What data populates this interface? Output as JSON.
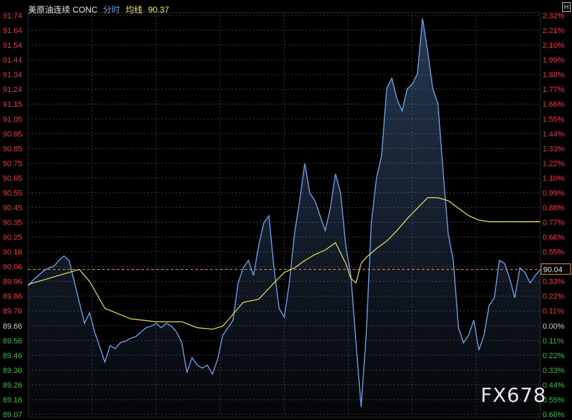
{
  "header": {
    "instrument": "美原油连续 CONC",
    "mode": "分时",
    "avg_label": "均线",
    "avg_value": "90.37"
  },
  "current_price_tag": "90.04",
  "watermark": "FX678",
  "corner_button": "H",
  "colors": {
    "background": "#000000",
    "price_line": "#6c9ee8",
    "avg_line": "#e8e85a",
    "up_text": "#e8343a",
    "down_text": "#2fbf3a",
    "ref_line": "#e09a5a",
    "grid": "#3a3a3a"
  },
  "chart_data": {
    "type": "line",
    "title": "",
    "reference_price": 89.66,
    "ylim": [
      89.07,
      91.74
    ],
    "x_range": [
      0,
      100
    ],
    "grid": true,
    "y_ticks_left": [
      "91.74",
      "91.64",
      "91.54",
      "91.44",
      "91.34",
      "91.24",
      "91.15",
      "91.05",
      "90.95",
      "90.85",
      "90.75",
      "90.65",
      "90.55",
      "90.45",
      "90.35",
      "90.25",
      "90.16",
      "90.06",
      "89.96",
      "89.86",
      "89.76",
      "89.66",
      "89.56",
      "89.46",
      "89.36",
      "89.26",
      "89.16",
      "89.07"
    ],
    "y_ticks_right": [
      "2.32%",
      "2.21%",
      "2.10%",
      "1.99%",
      "1.88%",
      "1.77%",
      "1.66%",
      "1.55%",
      "1.44%",
      "1.33%",
      "1.22%",
      "1.10%",
      "0.99%",
      "0.88%",
      "0.77%",
      "0.66%",
      "0.55%",
      "0.44%",
      "0.33%",
      "0.22%",
      "0.11%",
      "0.00%",
      "0.11%",
      "0.22%",
      "0.33%",
      "0.44%",
      "0.55%",
      "0.66%"
    ],
    "series": [
      {
        "key": "price",
        "x": [
          0,
          1,
          2,
          3,
          4,
          5,
          6,
          7,
          8,
          9,
          10,
          11,
          12,
          13,
          14,
          15,
          16,
          17,
          18,
          19,
          20,
          21,
          22,
          23,
          24,
          25,
          26,
          27,
          28,
          29,
          30,
          31,
          32,
          33,
          34,
          35,
          36,
          37,
          38,
          39,
          40,
          41,
          42,
          43,
          44,
          45,
          46,
          47,
          48,
          49,
          50,
          51,
          52,
          53,
          54,
          55,
          56,
          57,
          58,
          59,
          60,
          61,
          62,
          63,
          64,
          65,
          66,
          67,
          68,
          69,
          70,
          71,
          72,
          73,
          74,
          75,
          76,
          77,
          78,
          79,
          80,
          81,
          82,
          83,
          84,
          85,
          86,
          87,
          88,
          89,
          90,
          91,
          92,
          93,
          94,
          95,
          96,
          97,
          98,
          99,
          100
        ],
        "values": [
          89.93,
          89.97,
          90.0,
          90.03,
          90.05,
          90.06,
          90.1,
          90.13,
          90.1,
          89.96,
          89.82,
          89.68,
          89.75,
          89.62,
          89.52,
          89.42,
          89.53,
          89.51,
          89.55,
          89.56,
          89.58,
          89.59,
          89.62,
          89.65,
          89.66,
          89.68,
          89.65,
          89.68,
          89.66,
          89.62,
          89.55,
          89.35,
          89.45,
          89.4,
          89.38,
          89.4,
          89.34,
          89.44,
          89.6,
          89.65,
          89.7,
          89.95,
          90.05,
          90.1,
          90.0,
          90.2,
          90.35,
          90.4,
          90.05,
          89.78,
          89.72,
          89.95,
          90.28,
          90.5,
          90.75,
          90.55,
          90.5,
          90.4,
          90.3,
          90.45,
          90.68,
          90.55,
          90.2,
          90.0,
          89.55,
          89.12,
          89.6,
          90.35,
          90.65,
          90.8,
          91.25,
          91.32,
          91.18,
          91.1,
          91.25,
          91.28,
          91.35,
          91.72,
          91.5,
          91.25,
          91.15,
          90.7,
          90.28,
          90.1,
          89.65,
          89.55,
          89.6,
          89.7,
          89.5,
          89.6,
          89.8,
          89.85,
          90.1,
          90.08,
          89.98,
          89.85,
          90.05,
          90.02,
          89.95,
          90.0,
          90.04
        ]
      },
      {
        "key": "average",
        "x": [
          0,
          5,
          10,
          12,
          15,
          20,
          25,
          30,
          33,
          36,
          38,
          42,
          45,
          48,
          50,
          52,
          54,
          56,
          58,
          60,
          62,
          63,
          64,
          65,
          66,
          68,
          70,
          72,
          74,
          76,
          78,
          80,
          82,
          84,
          86,
          88,
          90,
          92,
          95,
          98,
          100
        ],
        "values": [
          89.94,
          89.99,
          90.04,
          89.96,
          89.78,
          89.71,
          89.69,
          89.69,
          89.65,
          89.64,
          89.66,
          89.82,
          89.84,
          89.95,
          90.02,
          90.05,
          90.1,
          90.14,
          90.17,
          90.22,
          90.08,
          89.98,
          89.95,
          90.08,
          90.12,
          90.18,
          90.23,
          90.3,
          90.38,
          90.45,
          90.52,
          90.52,
          90.5,
          90.45,
          90.4,
          90.37,
          90.36,
          90.36,
          90.36,
          90.36,
          90.36
        ]
      }
    ]
  }
}
